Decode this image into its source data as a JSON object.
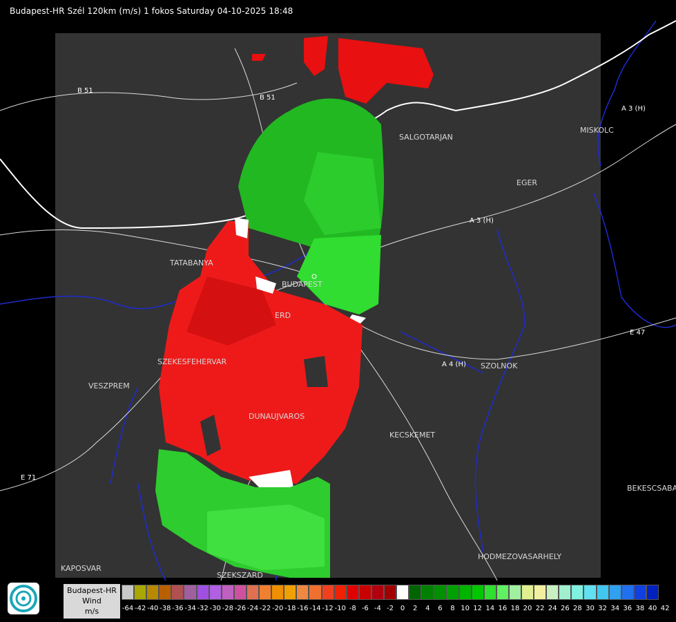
{
  "header": {
    "title": "Budapest-HR Szél 120km (m/s) 1 fokos Saturday 04-10-2025 18:48"
  },
  "map": {
    "cities": [
      {
        "name": "SALGOTARJAN"
      },
      {
        "name": "MISKOLC"
      },
      {
        "name": "EGER"
      },
      {
        "name": "TATABANYA"
      },
      {
        "name": "BUDAPEST"
      },
      {
        "name": "ERD"
      },
      {
        "name": "SZEKESFEHERVAR"
      },
      {
        "name": "VESZPREM"
      },
      {
        "name": "DUNAUJVAROS"
      },
      {
        "name": "KECSKEMET"
      },
      {
        "name": "SZOLNOK"
      },
      {
        "name": "BEKESCSABA"
      },
      {
        "name": "HODMEZOVASARHELY"
      },
      {
        "name": "KAPOSVAR"
      },
      {
        "name": "SZEKSZARD"
      }
    ],
    "roads": [
      "B 51",
      "B 51",
      "A 3 (H)",
      "A 3 (H)",
      "A 4 (H)",
      "E 47",
      "E 71"
    ],
    "colors": {
      "background": "#000000",
      "coverage": "#333333",
      "border": "#ffffff",
      "rivers": "#1e2bd0",
      "roads": "#dddddd",
      "approach": "#ff0000",
      "recede": "#00cc00"
    }
  },
  "legend": {
    "label_lines": [
      "Budapest-HR",
      "Wind",
      "m/s"
    ],
    "values": [
      "-64",
      "-42",
      "-40",
      "-38",
      "-36",
      "-34",
      "-32",
      "-30",
      "-28",
      "-26",
      "-24",
      "-22",
      "-20",
      "-18",
      "-16",
      "-14",
      "-12",
      "-10",
      "-8",
      "-6",
      "-4",
      "-2",
      "0",
      "2",
      "4",
      "6",
      "8",
      "10",
      "12",
      "14",
      "16",
      "18",
      "20",
      "22",
      "24",
      "26",
      "28",
      "30",
      "32",
      "34",
      "36",
      "38",
      "40",
      "42"
    ],
    "colors": [
      "#c8c8c8",
      "#a8a800",
      "#b88800",
      "#b86000",
      "#b05050",
      "#a060a0",
      "#a050e0",
      "#b060e0",
      "#c060c0",
      "#d050a0",
      "#e07050",
      "#f08030",
      "#f09000",
      "#f0a000",
      "#f08840",
      "#f07030",
      "#f04020",
      "#f02000",
      "#e00000",
      "#c80000",
      "#b00010",
      "#a00000",
      "#ffffff",
      "#006400",
      "#008000",
      "#009000",
      "#00a000",
      "#00b400",
      "#00c800",
      "#30e030",
      "#60f060",
      "#a0f0a0",
      "#e0f090",
      "#f0f0a0",
      "#c8f0c0",
      "#a0f0d0",
      "#80f0e0",
      "#60e0f0",
      "#40c8f0",
      "#30a0f0",
      "#2070f0",
      "#1040e0",
      "#0020c0"
    ]
  }
}
